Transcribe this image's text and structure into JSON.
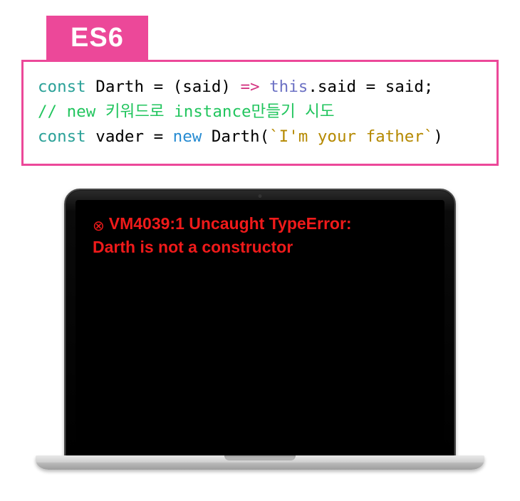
{
  "badge": {
    "label": "ES6"
  },
  "code": {
    "l1": {
      "kw1": "const",
      "name1": "Darth",
      "eq": "=",
      "lp": "(",
      "param": "said",
      "rp": ")",
      "arrow": "=>",
      "this": "this",
      "dot": ".",
      "prop": "said",
      "eq2": "=",
      "rhs": "said",
      "semi": ";"
    },
    "l2": {
      "comment": "// new 키워드로 instance만들기 시도"
    },
    "l3": {
      "kw1": "const",
      "name1": "vader",
      "eq": "=",
      "kw2": "new",
      "ctor": "Darth",
      "lp": "(",
      "str": "`I'm your father`",
      "rp": ")"
    }
  },
  "error": {
    "icon": "⊗",
    "line1": "VM4039:1 Uncaught TypeError:",
    "line2": "Darth is not a constructor"
  }
}
